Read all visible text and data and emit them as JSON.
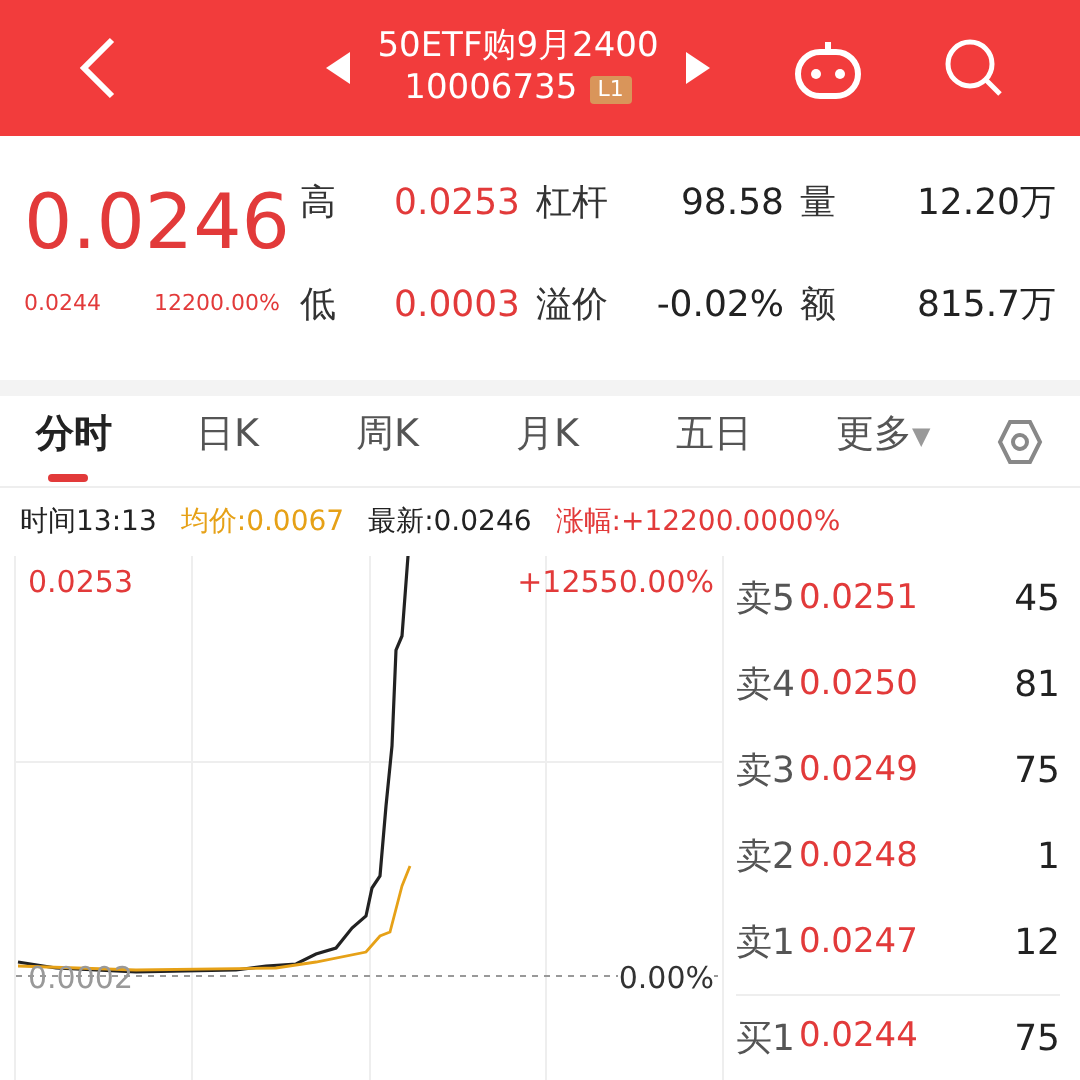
{
  "header": {
    "title": "50ETF购9月2400",
    "code": "10006735",
    "level_badge": "L1"
  },
  "quote": {
    "price": "0.0244",
    "last": "0.0246",
    "change_pct": "12200.00%",
    "stats": [
      {
        "label": "高",
        "value": "0.0253",
        "red": true
      },
      {
        "label": "杠杆",
        "value": "98.58",
        "red": false
      },
      {
        "label": "量",
        "value": "12.20万",
        "red": false
      },
      {
        "label": "低",
        "value": "0.0003",
        "red": true
      },
      {
        "label": "溢价",
        "value": "-0.02%",
        "red": false
      },
      {
        "label": "额",
        "value": "815.7万",
        "red": false
      }
    ]
  },
  "tabs": [
    {
      "label": "分时",
      "selected": true
    },
    {
      "label": "日K",
      "selected": false
    },
    {
      "label": "周K",
      "selected": false
    },
    {
      "label": "月K",
      "selected": false
    },
    {
      "label": "五日",
      "selected": false
    },
    {
      "label": "更多",
      "selected": false,
      "caret": "▼"
    }
  ],
  "info_bar": [
    {
      "label": "时间",
      "value": "13:13",
      "color": "#222222"
    },
    {
      "label": "均价:",
      "value": "0.0067",
      "color": "#e6a117"
    },
    {
      "label": "最新:",
      "value": "0.0246",
      "color": "#222222"
    },
    {
      "label": "涨幅:",
      "value": "+12200.0000%",
      "color": "#e23a3a"
    }
  ],
  "chart": {
    "top_price": "0.0253",
    "top_pct": "+12550.00%",
    "base_price": "0.0002",
    "base_pct": "0.00%"
  },
  "order_book": [
    {
      "side": "卖5",
      "price": "0.0251",
      "volume": "45"
    },
    {
      "side": "卖4",
      "price": "0.0250",
      "volume": "81"
    },
    {
      "side": "卖3",
      "price": "0.0249",
      "volume": "75"
    },
    {
      "side": "卖2",
      "price": "0.0248",
      "volume": "1"
    },
    {
      "side": "卖1",
      "price": "0.0247",
      "volume": "12"
    },
    {
      "side": "买1",
      "price": "0.0244",
      "volume": "75"
    }
  ]
}
